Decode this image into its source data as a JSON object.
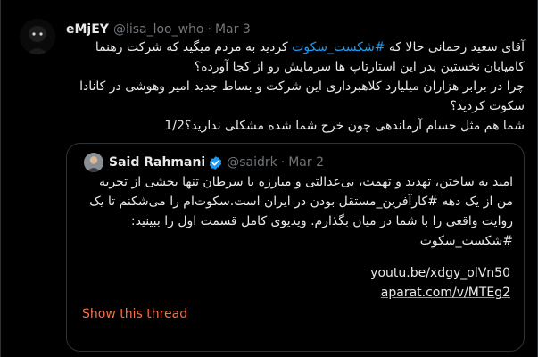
{
  "tweet": {
    "display_name": "eMjEY",
    "handle": "@lisa_loo_who",
    "separator": "·",
    "date": "Mar 3",
    "lines": [
      {
        "before": "آقای سعید رحمانی حالا که ",
        "tag": "#شکست_سکوت",
        "after": " کردید به مردم میگید که شرکت رهنما"
      },
      {
        "before": "کامیابان نخستین پدر این استارتاپ ها سرمایش رو از کجا آورده؟",
        "tag": "",
        "after": ""
      },
      {
        "before": "چرا در برابر هزاران میلیارد کلاهبرداری این شرکت و بساط جدید امیر وهوشی در کانادا",
        "tag": "",
        "after": ""
      },
      {
        "before": "سکوت کردید؟",
        "tag": "",
        "after": ""
      },
      {
        "before": "شما هم مثل حسام آرماندهی چون خرج شما شده مشکلی ندارید؟1/2",
        "tag": "",
        "after": ""
      }
    ]
  },
  "quote": {
    "display_name": "Said Rahmani",
    "handle": "@saidrk",
    "separator": "·",
    "date": "Mar 2",
    "lines": [
      "امید به ساختن، تهدید و تهمت، بی‌عدالتی و مبارزه با سرطان تنها بخشی از تجربه",
      "من از یک دهه #کارآفرین_مستقل بودن در ایران است.سکوت‌ام را می‌شکنم تا یک",
      "روایت واقعی را با شما در میان بگذارم. ویدیوی کامل قسمت اول را ببینید:",
      "#شکست_سکوت"
    ],
    "links": [
      "youtu.be/xdgy_olVn50",
      "aparat.com/v/MTEg2"
    ],
    "show_thread": "Show this thread"
  },
  "colors": {
    "background": "#000000",
    "text": "#e7e9ea",
    "muted": "#71767b",
    "accent": "#1d9bf0",
    "border": "#2f3336",
    "show_thread": "#f4714a"
  },
  "icons": {
    "avatar": "avatar-dark-figure",
    "quote_avatar": "avatar-photo",
    "verified": "verified-badge-icon"
  }
}
